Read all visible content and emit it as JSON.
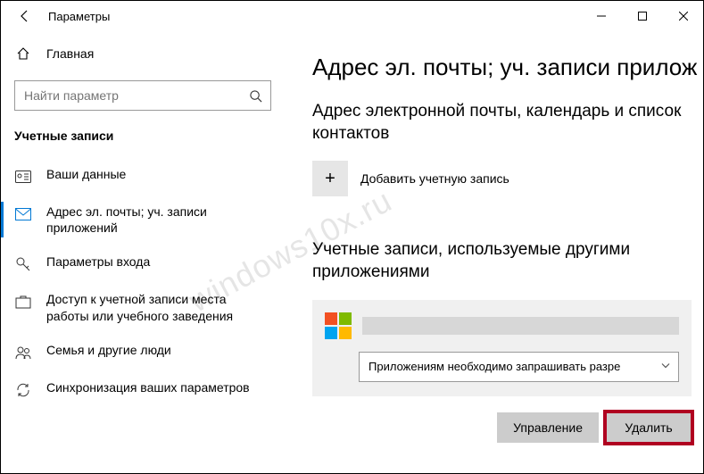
{
  "window": {
    "title": "Параметры"
  },
  "sidebar": {
    "home": "Главная",
    "search_placeholder": "Найти параметр",
    "section": "Учетные записи",
    "items": [
      {
        "label": "Ваши данные"
      },
      {
        "label": "Адрес эл. почты; уч. записи приложений"
      },
      {
        "label": "Параметры входа"
      },
      {
        "label": "Доступ к учетной записи места работы или учебного заведения"
      },
      {
        "label": "Семья и другие люди"
      },
      {
        "label": "Синхронизация ваших параметров"
      }
    ]
  },
  "main": {
    "title": "Адрес эл. почты; уч. записи прилож",
    "heading1": "Адрес электронной почты, календарь и список контактов",
    "add_account": "Добавить учетную запись",
    "heading2": "Учетные записи, используемые другими приложениями",
    "dropdown_value": "Приложениям необходимо запрашивать разре",
    "manage_btn": "Управление",
    "delete_btn": "Удалить"
  },
  "watermark": "windows10x.ru"
}
